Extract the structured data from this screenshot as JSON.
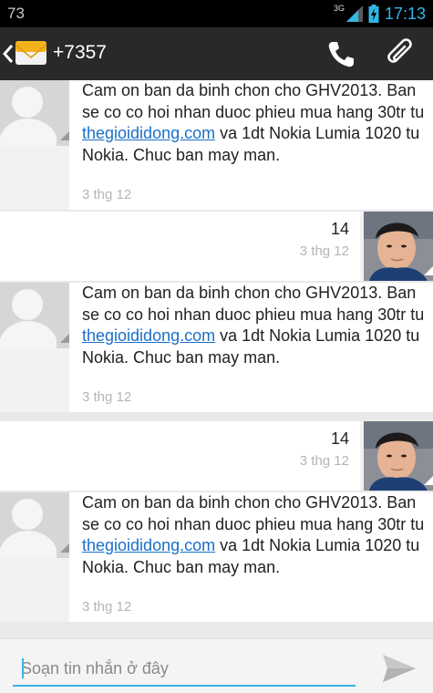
{
  "status_bar": {
    "notification_count": "73",
    "network_type": "3G",
    "time": "17:13"
  },
  "header": {
    "contact": "+7357"
  },
  "messages": [
    {
      "direction": "in",
      "text": {
        "pre": "Cam on ban da binh chon cho GHV2013. Ban se co co hoi nhan duoc phieu mua hang 30tr tu ",
        "link": "thegioididong.com",
        "post": " va 1dt Nokia Lumia 1020 tu Nokia. Chuc ban may man."
      },
      "time": "3 thg 12"
    },
    {
      "direction": "out",
      "text": "14",
      "time": "3 thg 12"
    },
    {
      "direction": "in",
      "text": {
        "pre": "Cam on ban da binh chon cho GHV2013. Ban se co co hoi nhan duoc phieu mua hang 30tr tu ",
        "link": "thegioididong.com",
        "post": " va 1dt Nokia Lumia 1020 tu Nokia. Chuc ban may man."
      },
      "time": "3 thg 12"
    },
    {
      "direction": "out",
      "text": "14",
      "time": "3 thg 12"
    },
    {
      "direction": "in",
      "text": {
        "pre": "Cam on ban da binh chon cho GHV2013. Ban se co co hoi nhan duoc phieu mua hang 30tr tu ",
        "link": "thegioididong.com",
        "post": " va 1dt Nokia Lumia 1020 tu Nokia. Chuc ban may man."
      },
      "time": "3 thg 12"
    }
  ],
  "compose": {
    "placeholder": "Soạn tin nhắn ở đây"
  },
  "icons": {
    "back": "chevron-left-icon",
    "contact": "envelope-icon",
    "call": "phone-icon",
    "attach": "paperclip-icon",
    "send": "send-icon"
  },
  "colors": {
    "accent": "#33b5e5",
    "link": "#1a6fc9",
    "action_bar": "#292929"
  }
}
